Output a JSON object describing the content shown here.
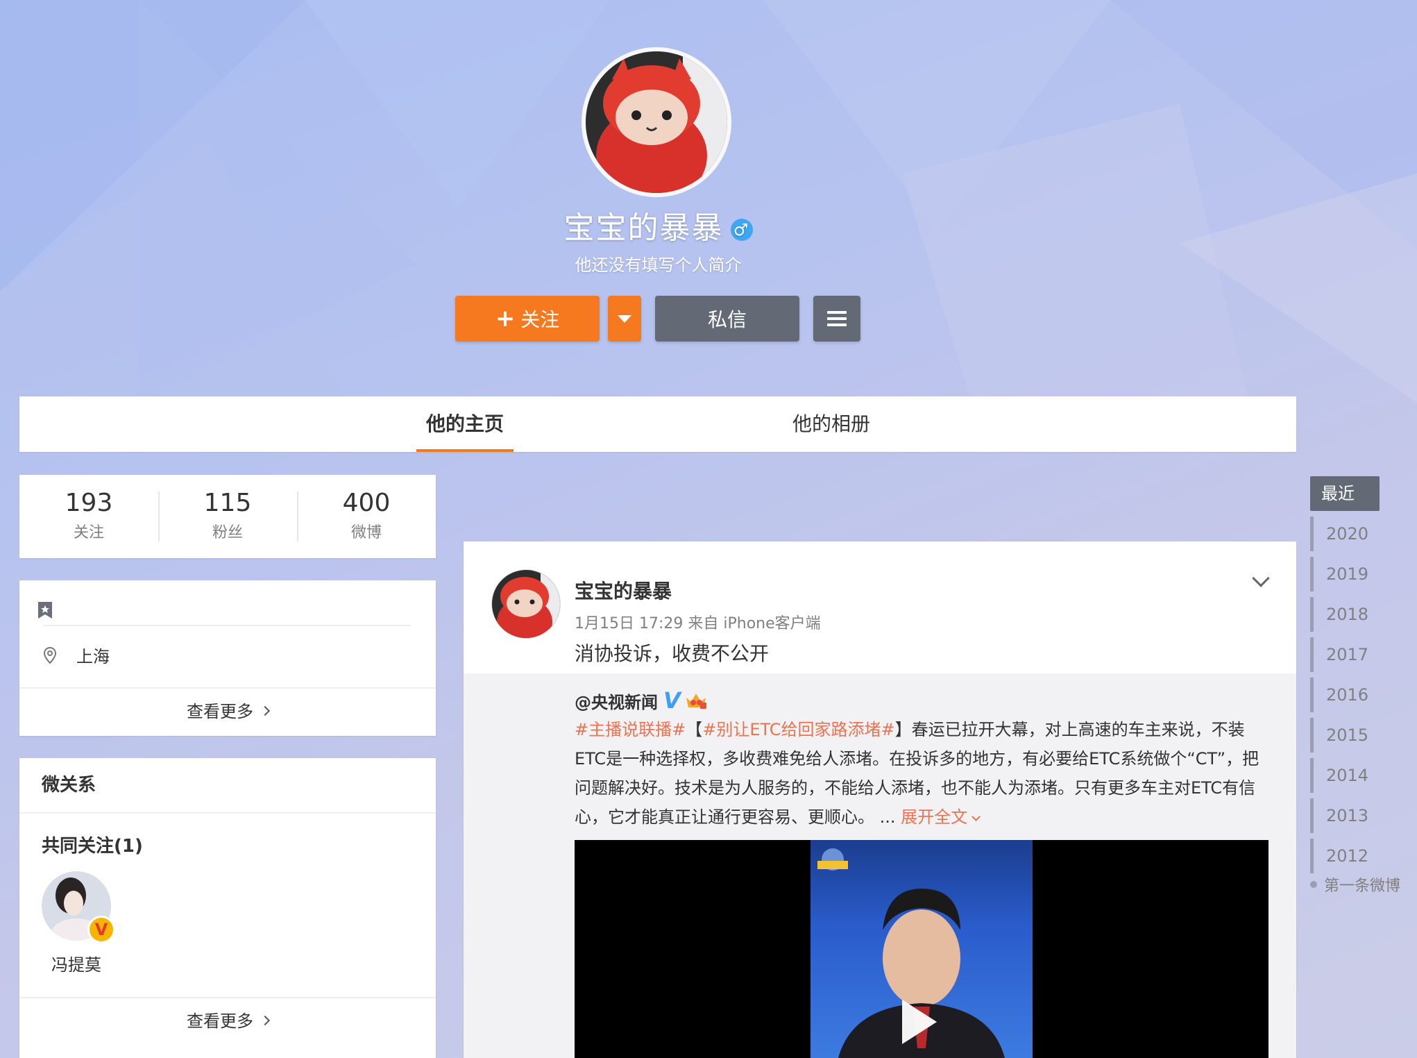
{
  "profile": {
    "nickname": "宝宝的暴暴",
    "gender_symbol": "♂",
    "intro": "他还没有填写个人简介",
    "follow_label": "关注",
    "message_label": "私信"
  },
  "tabs": [
    {
      "label": "他的主页",
      "active": true
    },
    {
      "label": "他的相册",
      "active": false
    }
  ],
  "stats": [
    {
      "value": "193",
      "label": "关注"
    },
    {
      "value": "115",
      "label": "粉丝"
    },
    {
      "value": "400",
      "label": "微博"
    }
  ],
  "info": {
    "location": "上海",
    "more_label": "查看更多"
  },
  "relations": {
    "title": "微关系",
    "common_title": "共同关注(1)",
    "user_name": "冯提莫",
    "badge": "V",
    "more_label": "查看更多"
  },
  "post": {
    "author": "宝宝的暴暴",
    "meta": "1月15日 17:29 来自 iPhone客户端",
    "text": "消协投诉，收费不公开",
    "repost": {
      "author": "@央视新闻",
      "verified_mark": "V",
      "tag1": "#主播说联播#",
      "bracket_open": "【",
      "tag2": "#别让ETC给回家路添堵#",
      "bracket_close": "】",
      "body": "春运已拉开大幕，对上高速的车主来说，不装ETC是一种选择权，多收费难免给人添堵。在投诉多的地方，有必要给ETC系统做个“CT”，把问题解决好。技术是为人服务的，不能给人添堵，也不能人为添堵。只有更多车主对ETC有信心，它才能真正让通行更容易、更顺心。",
      "ellipsis": " ... ",
      "expand_label": "展开全文"
    }
  },
  "timeline": {
    "recent": "最近",
    "years": [
      "2020",
      "2019",
      "2018",
      "2017",
      "2016",
      "2015",
      "2014",
      "2013",
      "2012"
    ],
    "first": "第一条微博"
  },
  "colors": {
    "accent": "#f7791f",
    "dark_button": "#636a76",
    "link": "#eb7350",
    "verified_blue": "#3f9ff2"
  },
  "icons": [
    "gender-male-icon",
    "caret-down-icon",
    "menu-icon",
    "bookmark-icon",
    "location-pin-icon",
    "chevron-right-icon",
    "chevron-down-icon",
    "verified-v-icon",
    "crown-icon",
    "play-icon"
  ]
}
